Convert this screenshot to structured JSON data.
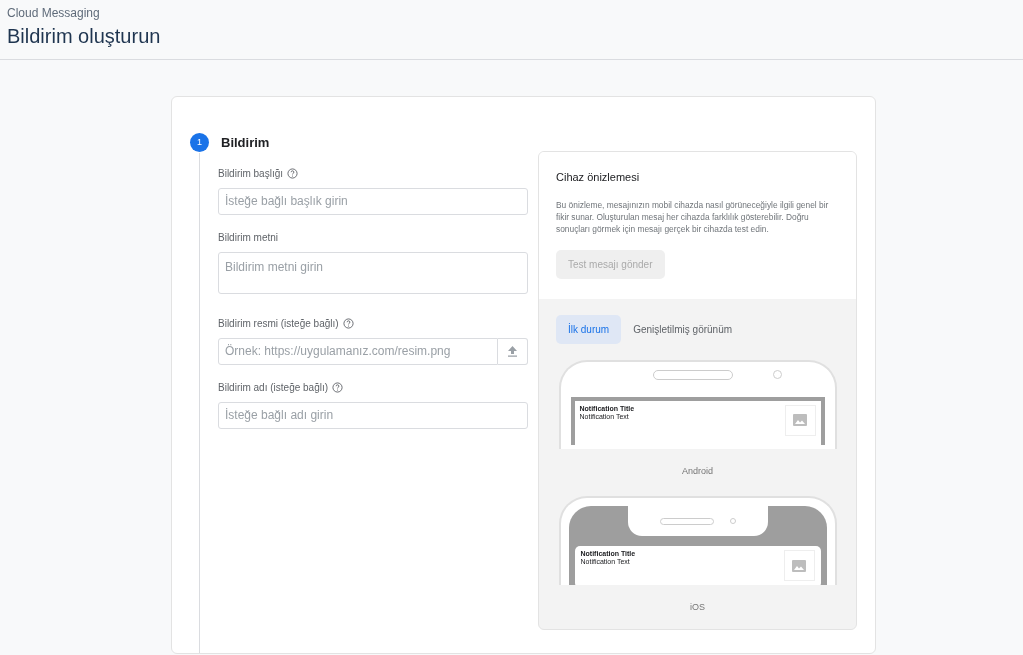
{
  "header": {
    "breadcrumb": "Cloud Messaging",
    "title": "Bildirim oluşturun"
  },
  "step": {
    "number": "1",
    "title": "Bildirim",
    "active": true
  },
  "fields": [
    {
      "kind": "input",
      "label": "Bildirim başlığı",
      "help": true,
      "placeholder": "İsteğe bağlı başlık girin"
    },
    {
      "kind": "textarea",
      "label": "Bildirim metni",
      "help": false,
      "placeholder": "Bildirim metni girin"
    },
    {
      "kind": "upload",
      "label": "Bildirim resmi (isteğe bağlı)",
      "help": true,
      "placeholder": "Örnek: https://uygulamanız.com/resim.png"
    },
    {
      "kind": "input",
      "label": "Bildirim adı (isteğe bağlı)",
      "help": true,
      "placeholder": "İsteğe bağlı adı girin"
    }
  ],
  "preview": {
    "title": "Cihaz önizlemesi",
    "description": "Bu önizleme, mesajınızın mobil cihazda nasıl görüneceğiyle ilgili genel bir fikir sunar. Oluşturulan mesaj her cihazda farklılık gösterebilir. Doğru sonuçları görmek için mesajı gerçek bir cihazda test edin.",
    "test_button": {
      "label": "Test mesajı gönder",
      "disabled": true
    },
    "tabs": [
      {
        "label": "İlk durum",
        "selected": true
      },
      {
        "label": "Genişletilmiş görünüm",
        "selected": false
      }
    ],
    "devices": [
      {
        "kind": "android",
        "label": "Android",
        "notification_title": "Notification Title",
        "notification_text": "Notification Text"
      },
      {
        "kind": "ios",
        "label": "iOS",
        "notification_title": "Notification Title",
        "notification_text": "Notification Text"
      }
    ]
  }
}
